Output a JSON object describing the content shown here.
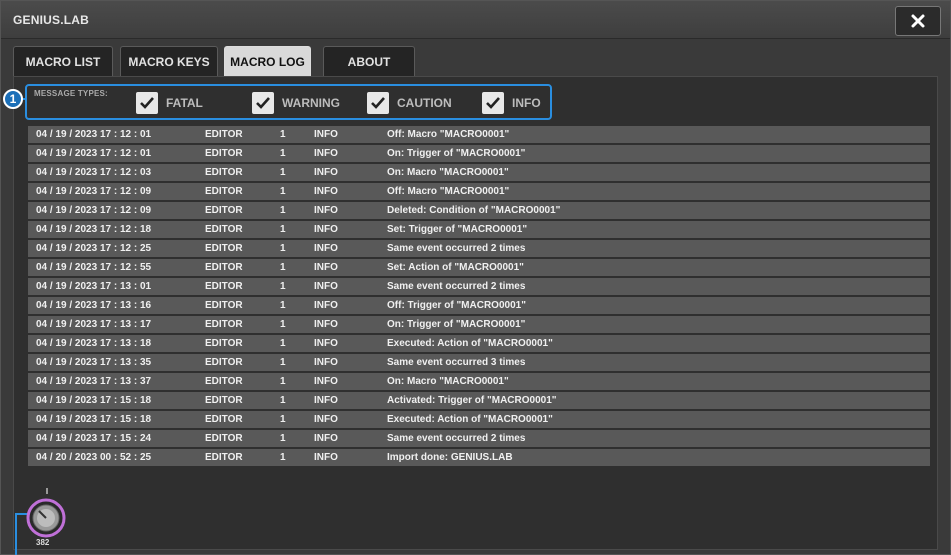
{
  "window": {
    "title": "GENIUS.LAB"
  },
  "tabs": [
    {
      "label": "MACRO LIST",
      "active": false
    },
    {
      "label": "MACRO KEYS",
      "active": false
    },
    {
      "label": "MACRO LOG",
      "active": true
    },
    {
      "label": "ABOUT",
      "active": false
    }
  ],
  "filter": {
    "label": "MESSAGE TYPES:",
    "callout": "1",
    "types": [
      {
        "label": "FATAL",
        "checked": true
      },
      {
        "label": "WARNING",
        "checked": true
      },
      {
        "label": "CAUTION",
        "checked": true
      },
      {
        "label": "INFO",
        "checked": true
      }
    ]
  },
  "log": {
    "rows": [
      {
        "date": "04 / 19 / 2023  17 : 12 : 01",
        "source": "EDITOR",
        "num": "1",
        "level": "INFO",
        "message": "Off: Macro \"MACRO0001\""
      },
      {
        "date": "04 / 19 / 2023  17 : 12 : 01",
        "source": "EDITOR",
        "num": "1",
        "level": "INFO",
        "message": "On: Trigger of \"MACRO0001\""
      },
      {
        "date": "04 / 19 / 2023  17 : 12 : 03",
        "source": "EDITOR",
        "num": "1",
        "level": "INFO",
        "message": "On: Macro \"MACRO0001\""
      },
      {
        "date": "04 / 19 / 2023  17 : 12 : 09",
        "source": "EDITOR",
        "num": "1",
        "level": "INFO",
        "message": "Off: Macro \"MACRO0001\""
      },
      {
        "date": "04 / 19 / 2023  17 : 12 : 09",
        "source": "EDITOR",
        "num": "1",
        "level": "INFO",
        "message": "Deleted: Condition of \"MACRO0001\""
      },
      {
        "date": "04 / 19 / 2023  17 : 12 : 18",
        "source": "EDITOR",
        "num": "1",
        "level": "INFO",
        "message": "Set: Trigger of \"MACRO0001\""
      },
      {
        "date": "04 / 19 / 2023  17 : 12 : 25",
        "source": "EDITOR",
        "num": "1",
        "level": "INFO",
        "message": "Same event occurred 2 times"
      },
      {
        "date": "04 / 19 / 2023  17 : 12 : 55",
        "source": "EDITOR",
        "num": "1",
        "level": "INFO",
        "message": "Set: Action of \"MACRO0001\""
      },
      {
        "date": "04 / 19 / 2023  17 : 13 : 01",
        "source": "EDITOR",
        "num": "1",
        "level": "INFO",
        "message": "Same event occurred 2 times"
      },
      {
        "date": "04 / 19 / 2023  17 : 13 : 16",
        "source": "EDITOR",
        "num": "1",
        "level": "INFO",
        "message": "Off: Trigger of \"MACRO0001\""
      },
      {
        "date": "04 / 19 / 2023  17 : 13 : 17",
        "source": "EDITOR",
        "num": "1",
        "level": "INFO",
        "message": "On: Trigger of \"MACRO0001\""
      },
      {
        "date": "04 / 19 / 2023  17 : 13 : 18",
        "source": "EDITOR",
        "num": "1",
        "level": "INFO",
        "message": "Executed: Action of \"MACRO0001\""
      },
      {
        "date": "04 / 19 / 2023  17 : 13 : 35",
        "source": "EDITOR",
        "num": "1",
        "level": "INFO",
        "message": "Same event occurred 3 times"
      },
      {
        "date": "04 / 19 / 2023  17 : 13 : 37",
        "source": "EDITOR",
        "num": "1",
        "level": "INFO",
        "message": "On: Macro \"MACRO0001\""
      },
      {
        "date": "04 / 19 / 2023  17 : 15 : 18",
        "source": "EDITOR",
        "num": "1",
        "level": "INFO",
        "message": "Activated: Trigger of \"MACRO0001\""
      },
      {
        "date": "04 / 19 / 2023  17 : 15 : 18",
        "source": "EDITOR",
        "num": "1",
        "level": "INFO",
        "message": "Executed: Action of \"MACRO0001\""
      },
      {
        "date": "04 / 19 / 2023  17 : 15 : 24",
        "source": "EDITOR",
        "num": "1",
        "level": "INFO",
        "message": "Same event occurred 2 times"
      },
      {
        "date": "04 / 20 / 2023  00 : 52 : 25",
        "source": "EDITOR",
        "num": "1",
        "level": "INFO",
        "message": "Import done: GENIUS.LAB"
      }
    ]
  },
  "scroll_knob": {
    "value": "382",
    "accent": "#c070d8"
  },
  "colors": {
    "accent_blue": "#2a8ee0",
    "row_bg": "#595959",
    "knob_ring": "#c070d8"
  },
  "icons": {
    "close": "close-icon",
    "check": "check-icon",
    "knob": "knob-icon"
  }
}
